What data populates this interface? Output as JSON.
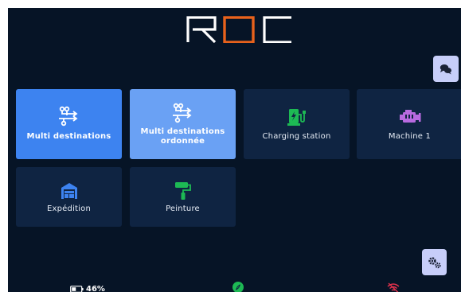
{
  "app": {
    "logo_text": "ROC"
  },
  "header": {
    "chat_button": {
      "icon": "chat-bubbles-icon"
    },
    "settings_button": {
      "icon": "gears-icon"
    }
  },
  "tiles": [
    {
      "label": "Multi destinations",
      "icon": "route-arrows-icon",
      "state": "selected",
      "color": "#3d83f0"
    },
    {
      "label": "Multi destinations ordonnée",
      "icon": "route-arrows-icon",
      "state": "hover",
      "color": "#6aa1f4"
    },
    {
      "label": "Charging station",
      "icon": "charging-station-icon",
      "state": "default",
      "color": "#1db954"
    },
    {
      "label": "Machine 1",
      "icon": "engine-icon",
      "state": "default",
      "color": "#b86ae0"
    },
    {
      "label": "Expédition",
      "icon": "warehouse-icon",
      "state": "default",
      "color": "#3d83f0"
    },
    {
      "label": "Peinture",
      "icon": "paint-roller-icon",
      "state": "default",
      "color": "#1db954"
    }
  ],
  "status_bar": {
    "battery_percent": "46%",
    "battery_level": 0.46,
    "compass_icon": "compass-icon",
    "wifi_icon": "wifi-off-icon"
  },
  "colors": {
    "background": "#061426",
    "tile": "#0f2442",
    "logo_accent": "#e8621c",
    "button_bg": "#c7cef9"
  }
}
